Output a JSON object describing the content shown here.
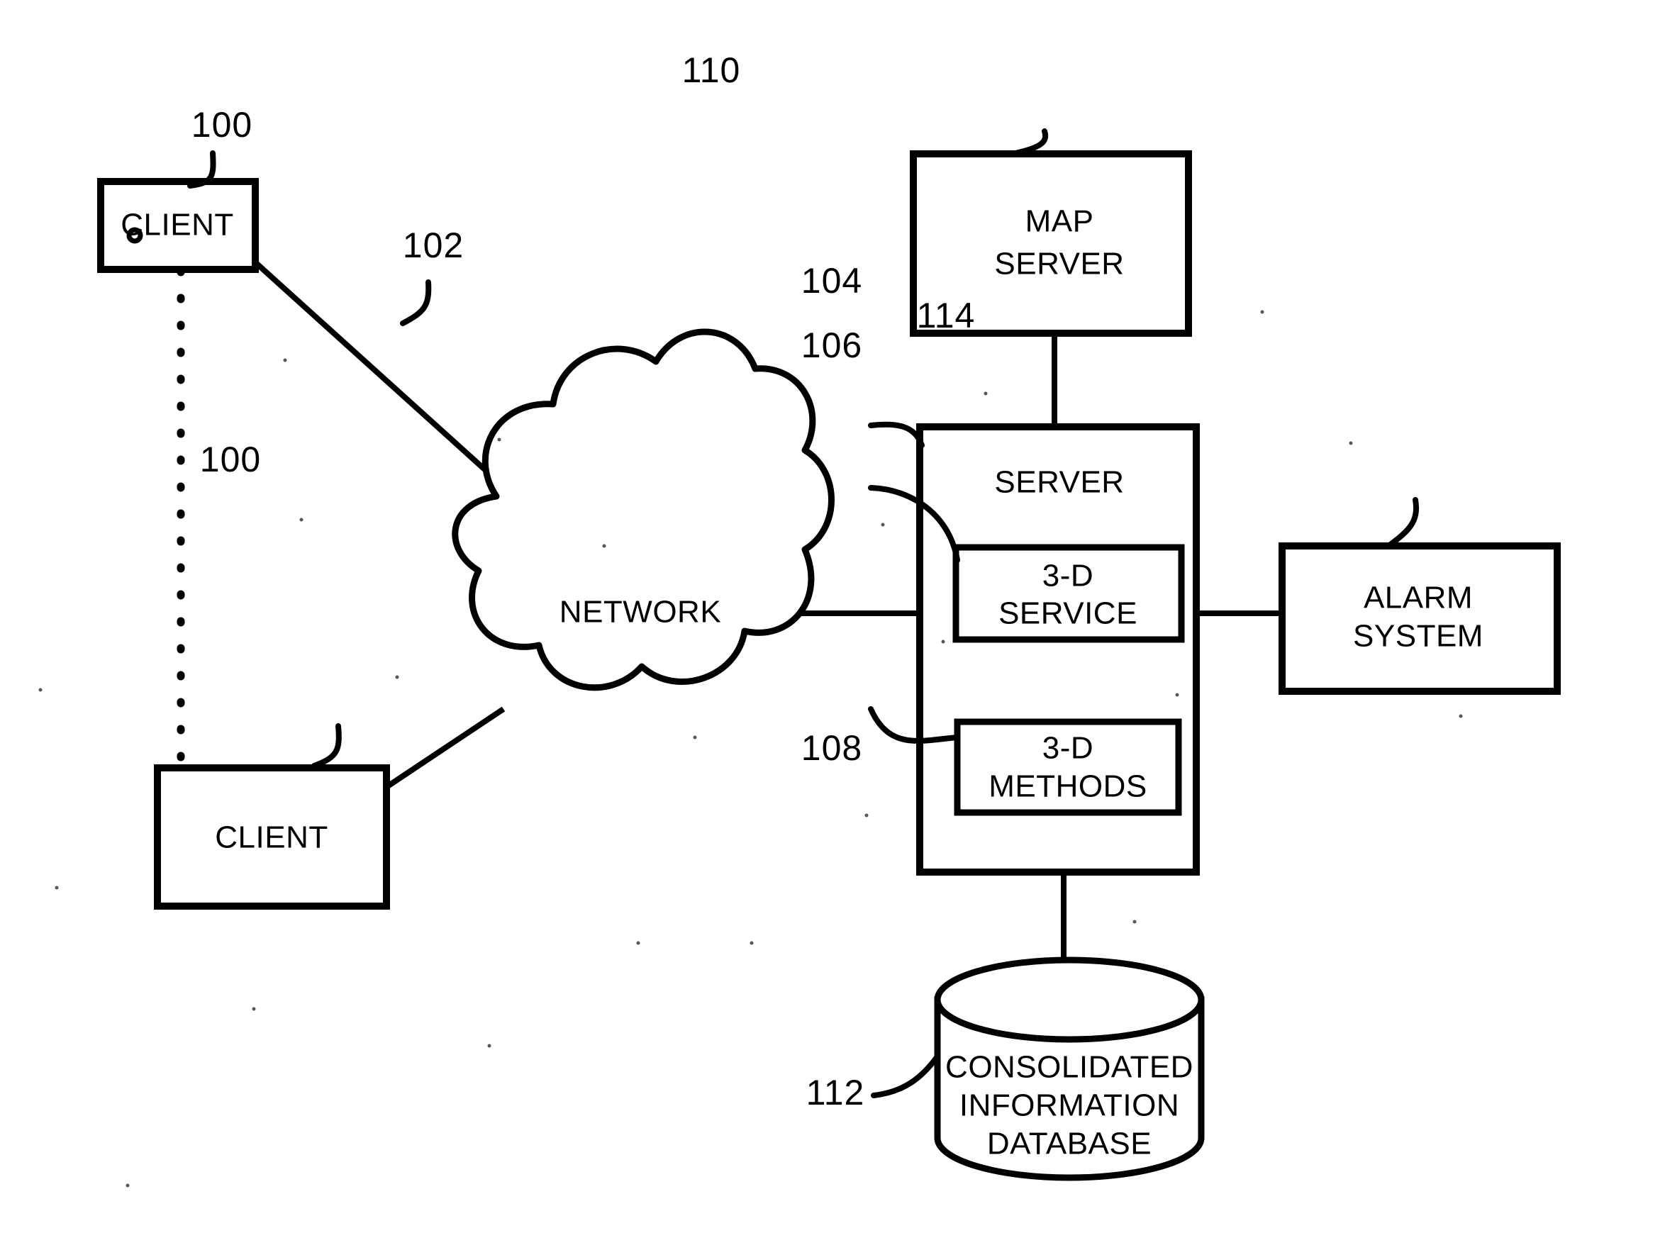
{
  "figure": {
    "type": "patent-system-block-diagram",
    "background_color": "#ffffff",
    "line_color": "#000000"
  },
  "nodes": {
    "client_top": {
      "label": "CLIENT",
      "reference_numeral": "100"
    },
    "client_bottom": {
      "label": "CLIENT",
      "reference_numeral": "100"
    },
    "network": {
      "label": "NETWORK",
      "reference_numeral": "102"
    },
    "map_server": {
      "label_line1": "MAP",
      "label_line2": "SERVER",
      "reference_numeral": "110"
    },
    "server": {
      "label": "SERVER",
      "reference_numeral": "104"
    },
    "three_d_service": {
      "label_line1": "3-D",
      "label_line2": "SERVICE",
      "reference_numeral": "106"
    },
    "three_d_methods": {
      "label_line1": "3-D",
      "label_line2": "METHODS",
      "reference_numeral": "108"
    },
    "alarm_system": {
      "label_line1": "ALARM",
      "label_line2": "SYSTEM",
      "reference_numeral": "114"
    },
    "database": {
      "label_line1": "CONSOLIDATED",
      "label_line2": "INFORMATION",
      "label_line3": "DATABASE",
      "reference_numeral": "112"
    }
  },
  "connections": [
    {
      "from": "client_top",
      "to": "network",
      "style": "solid"
    },
    {
      "from": "client_bottom",
      "to": "network",
      "style": "solid"
    },
    {
      "from": "client_top",
      "to": "client_bottom",
      "style": "dashed"
    },
    {
      "from": "network",
      "to": "server",
      "style": "solid"
    },
    {
      "from": "map_server",
      "to": "server",
      "style": "solid"
    },
    {
      "from": "server",
      "to": "alarm_system",
      "style": "solid"
    },
    {
      "from": "server",
      "to": "database",
      "style": "solid"
    },
    {
      "from": "three_d_service",
      "to": "three_d_methods",
      "style": "dashed"
    }
  ]
}
